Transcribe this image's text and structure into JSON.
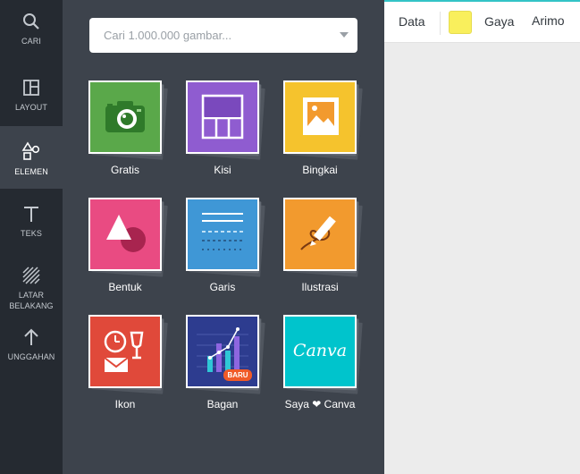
{
  "sidebar": {
    "items": [
      {
        "label": "CARI",
        "icon": "search-icon"
      },
      {
        "label": "LAYOUT",
        "icon": "layout-icon"
      },
      {
        "label": "ELEMEN",
        "icon": "shapes-icon"
      },
      {
        "label": "TEKS",
        "icon": "text-icon"
      },
      {
        "label": "LATAR\nBELAKANG",
        "icon": "background-pattern-icon"
      },
      {
        "label": "UNGGAHAN",
        "icon": "upload-arrow-icon"
      }
    ]
  },
  "search": {
    "placeholder": "Cari 1.000.000 gambar..."
  },
  "tiles": [
    {
      "label": "Gratis",
      "color": "#5aa84a"
    },
    {
      "label": "Kisi",
      "color": "#8f5cd0"
    },
    {
      "label": "Bingkai",
      "color": "#f5c32d"
    },
    {
      "label": "Bentuk",
      "color": "#e94b82"
    },
    {
      "label": "Garis",
      "color": "#3f97d6"
    },
    {
      "label": "Ilustrasi",
      "color": "#f29a2e"
    },
    {
      "label": "Ikon",
      "color": "#e0493a"
    },
    {
      "label": "Bagan",
      "color": "#2d3c8f",
      "badge": "BARU"
    },
    {
      "label": "Saya ❤ Canva",
      "color": "#00c4cc",
      "logo": "Canva"
    }
  ],
  "toolbar": {
    "data_label": "Data",
    "swatch_color": "#f9ef5c",
    "style_label": "Gaya",
    "font_label": "Arimo"
  }
}
